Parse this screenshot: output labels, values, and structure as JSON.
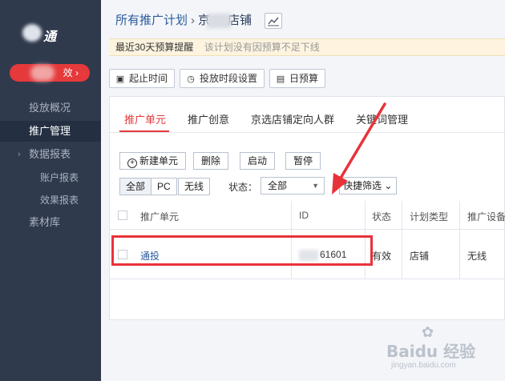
{
  "sidebar": {
    "logo_text": "通",
    "promo_badge": "效 ›",
    "items": [
      {
        "label": "投放概况"
      },
      {
        "label": "推广管理"
      },
      {
        "label": "数据报表"
      },
      {
        "label": "账户报表"
      },
      {
        "label": "效果报表"
      },
      {
        "label": "素材库"
      }
    ],
    "expand_arrow": "›"
  },
  "header": {
    "crumb_root": "所有推广计划",
    "crumb_sep": "›",
    "crumb_current_a": "京",
    "crumb_current_b": "店铺"
  },
  "notice": {
    "title": "最近30天预算提醒",
    "message": "该计划没有因预算不足下线"
  },
  "toolbar": {
    "start_time": "起止时间",
    "schedule": "投放时段设置",
    "daily_budget": "日预算"
  },
  "tabs": [
    {
      "label": "推广单元"
    },
    {
      "label": "推广创意"
    },
    {
      "label": "京选店铺定向人群"
    },
    {
      "label": "关键词管理"
    }
  ],
  "actions": {
    "new_unit": "新建单元",
    "delete": "删除",
    "enable": "启动",
    "pause": "暂停"
  },
  "filters": {
    "segments": [
      "全部",
      "PC",
      "无线"
    ],
    "status_label": "状态：",
    "status_value": "全部",
    "quick_filter": "快捷筛选 ⌄"
  },
  "table": {
    "columns": [
      "推广单元",
      "ID",
      "状态",
      "计划类型",
      "推广设备"
    ],
    "rows": [
      {
        "unit": "通投",
        "id_suffix": "61601",
        "status": "有效",
        "plan_type": "店铺",
        "device": "无线"
      }
    ]
  },
  "watermark": {
    "brand": "Baidu 经验",
    "url": "jingyan.baidu.com"
  },
  "colors": {
    "sidebar_bg": "#2f3a4c",
    "accent_red": "#e4393c",
    "link_blue": "#2a5b9c",
    "notice_bg": "#fdf3df"
  }
}
